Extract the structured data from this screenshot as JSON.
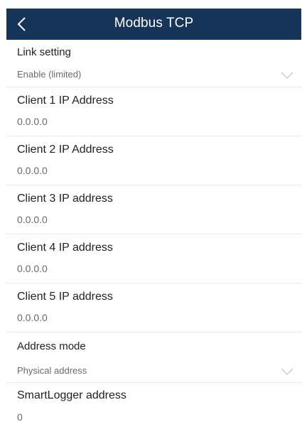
{
  "header": {
    "title": "Modbus TCP",
    "back_icon": "chevron-left-icon"
  },
  "fields": {
    "link_setting": {
      "label": "Link setting",
      "value": "Enable (limited)",
      "icon": "chevron-down-icon"
    },
    "client1": {
      "label": "Client 1 IP Address",
      "value": "0.0.0.0"
    },
    "client2": {
      "label": "Client 2 IP Address",
      "value": "0.0.0.0"
    },
    "client3": {
      "label": "Client 3 IP address",
      "value": "0.0.0.0"
    },
    "client4": {
      "label": "Client 4 IP address",
      "value": "0.0.0.0"
    },
    "client5": {
      "label": "Client 5 IP address",
      "value": "0.0.0.0"
    },
    "address_mode": {
      "label": "Address mode",
      "value": "Physical address",
      "icon": "chevron-down-icon"
    },
    "smartlogger_address": {
      "label": "SmartLogger address",
      "value": "0"
    }
  },
  "colors": {
    "header_bg": "#173559",
    "header_text": "#ffffff",
    "label_text": "#222222",
    "value_text": "#6a6a6a",
    "divider": "#e8e8e8",
    "chevron": "#c8c8c8"
  }
}
